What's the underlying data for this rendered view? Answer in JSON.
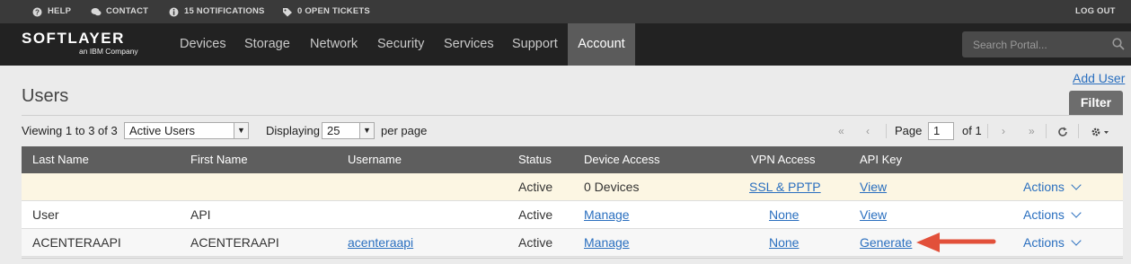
{
  "utility": {
    "help": "HELP",
    "contact": "CONTACT",
    "notifications": "15 NOTIFICATIONS",
    "tickets": "0 OPEN TICKETS",
    "logout": "LOG OUT"
  },
  "brand": {
    "name": "SOFTLAYER",
    "sub": "an IBM Company"
  },
  "nav": {
    "items": [
      "Devices",
      "Storage",
      "Network",
      "Security",
      "Services",
      "Support",
      "Account"
    ],
    "active": "Account"
  },
  "search": {
    "placeholder": "Search Portal..."
  },
  "page": {
    "title": "Users",
    "add_user": "Add User",
    "filter": "Filter"
  },
  "toolbar": {
    "viewing": "Viewing 1 to 3 of 3",
    "user_filter": "Active Users",
    "displaying": "Displaying",
    "per_page_value": "25",
    "per_page": "per page",
    "page_label": "Page",
    "page_value": "1",
    "of_pages": "of 1",
    "first": "«",
    "prev": "‹",
    "next": "›",
    "last": "»"
  },
  "table": {
    "columns": [
      "Last Name",
      "First Name",
      "Username",
      "Status",
      "Device Access",
      "VPN Access",
      "API Key"
    ],
    "rows": [
      {
        "last": "",
        "first": "",
        "username": "",
        "status": "Active",
        "device": "0 Devices",
        "vpn": "SSL & PPTP",
        "api": "View",
        "actions": "Actions"
      },
      {
        "last": "User",
        "first": "API",
        "username": "",
        "status": "Active",
        "device": "Manage",
        "vpn": "None",
        "api": "View",
        "actions": "Actions"
      },
      {
        "last": "ACENTERAAPI",
        "first": "ACENTERAAPI",
        "username": "acenteraapi",
        "status": "Active",
        "device": "Manage",
        "vpn": "None",
        "api": "Generate",
        "actions": "Actions"
      }
    ]
  },
  "colors": {
    "nav_bg": "#222222",
    "link": "#2a6fbf",
    "highlight_row": "#fcf6e3",
    "arrow": "#e2503a"
  }
}
